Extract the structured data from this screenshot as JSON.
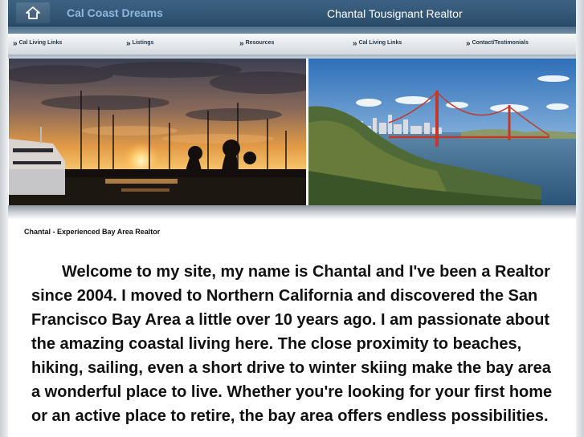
{
  "header": {
    "home_icon": "home-icon",
    "site_title": "Cal Coast Dreams",
    "realtor_name": "Chantal Tousignant Realtor"
  },
  "nav": {
    "arrow_glyph": "»",
    "items": [
      {
        "label": "Cal Living Links"
      },
      {
        "label": "Listings"
      },
      {
        "label": "Resources"
      },
      {
        "label": "Cal Living Links"
      },
      {
        "label": "Contact/Testimonials"
      }
    ]
  },
  "banner": {
    "left_photo": "marina-sunset-photo",
    "right_photo": "golden-gate-bridge-photo"
  },
  "content": {
    "heading": "Chantal - Experienced Bay Area Realtor",
    "intro": "Welcome to my site, my name is Chantal and I've been a Realtor since 2004. I moved to Northern California and discovered the San Francisco Bay Area a little over 10 years ago.   I am passionate about the amazing coastal living here. The close proximity to beaches, hiking, sailing, even a short drive to winter skiing make the bay area a wonderful place to live. Whether you're looking for your first home or an active place to retire, the bay area offers endless possibilities."
  },
  "colors": {
    "header_bar": "#2b4d6b",
    "site_title": "#8fb8e0",
    "header_text": "#ffffff",
    "body_text": "#111111"
  }
}
